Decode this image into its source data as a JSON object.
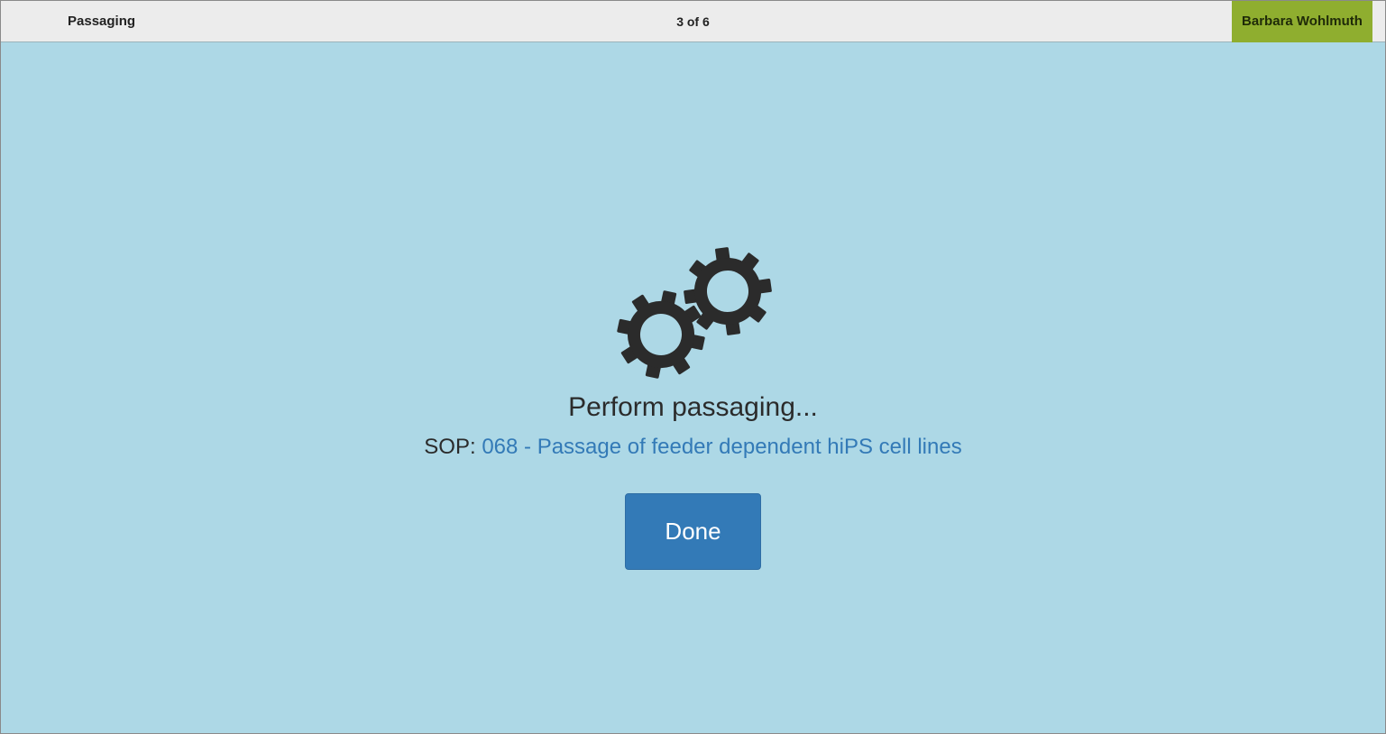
{
  "header": {
    "step_title": "Passaging",
    "step_counter": "3 of 6",
    "user_name": "Barbara Wohlmuth"
  },
  "main": {
    "status_icon": "gears-icon",
    "headline": "Perform passaging...",
    "sop_label": "SOP:",
    "sop_link_text": "068 - Passage of feeder dependent hiPS cell lines",
    "done_label": "Done"
  },
  "colors": {
    "background": "#add8e6",
    "header_bg": "#ececec",
    "user_badge": "#8fae2f",
    "primary_button": "#337ab7",
    "link": "#337ab7",
    "icon": "#2b2b2b"
  }
}
